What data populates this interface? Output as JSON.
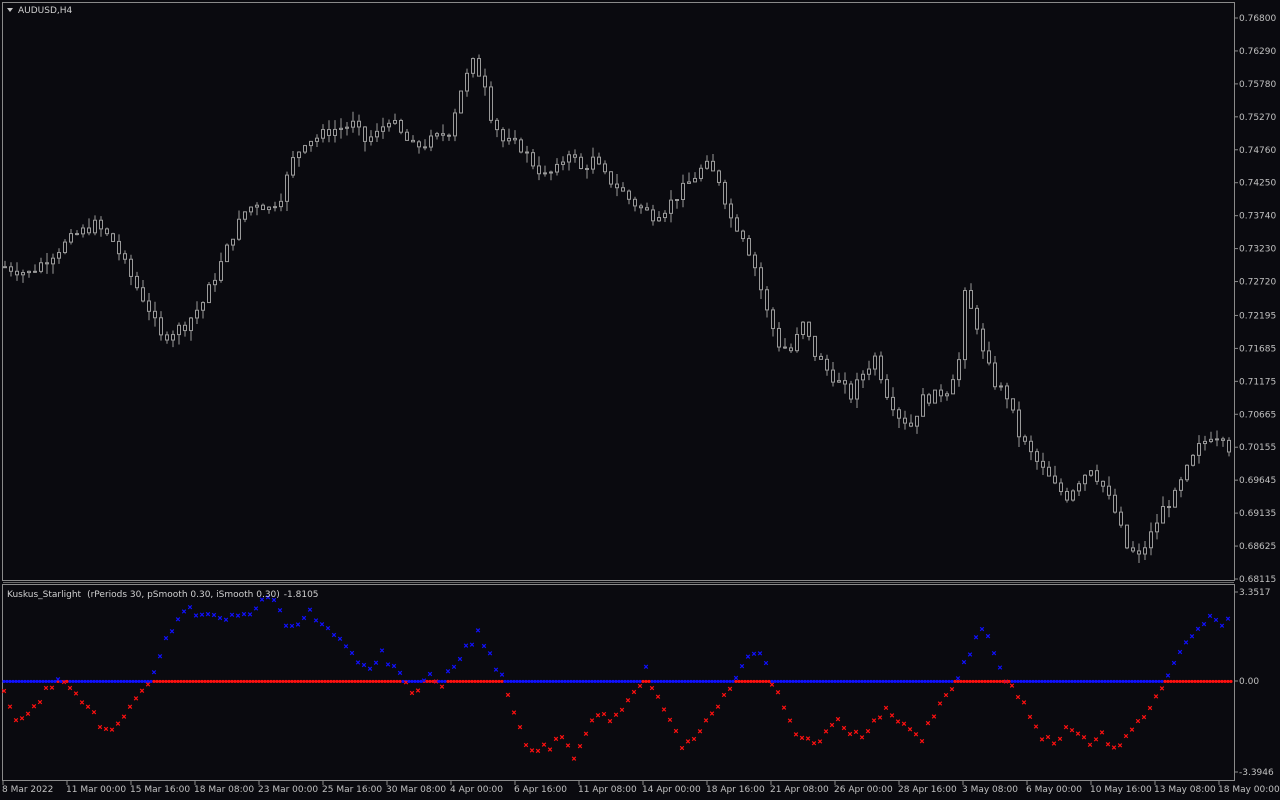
{
  "window": {
    "symbol": "AUDUSD,H4"
  },
  "indicator": {
    "label": "Kuskus_Starlight",
    "params": "(rPeriods 30, pSmooth 0.30, iSmooth 0.30)",
    "value": "-1.8105",
    "max_label": "3.3517",
    "zero_label": "0.00",
    "min_label": "-3.3946"
  },
  "colors": {
    "background": "#0a0a0f",
    "frame": "#8a8a8a",
    "candle": "#9a9a9a",
    "positive": "#1010ff",
    "negative": "#ff1010"
  },
  "price_axis": [
    "0.76800",
    "0.76290",
    "0.75780",
    "0.75270",
    "0.74760",
    "0.74250",
    "0.73740",
    "0.73230",
    "0.72720",
    "0.72195",
    "0.71685",
    "0.71175",
    "0.70665",
    "0.70155",
    "0.69645",
    "0.69135",
    "0.68625",
    "0.68115"
  ],
  "time_axis": [
    "8 Mar 2022",
    "11 Mar 00:00",
    "15 Mar 16:00",
    "18 Mar 08:00",
    "23 Mar 00:00",
    "25 Mar 16:00",
    "30 Mar 08:00",
    "4 Apr 00:00",
    "6 Apr 16:00",
    "11 Apr 08:00",
    "14 Apr 00:00",
    "18 Apr 16:00",
    "21 Apr 08:00",
    "26 Apr 00:00",
    "28 Apr 16:00",
    "3 May 08:00",
    "6 May 00:00",
    "10 May 16:00",
    "13 May 08:00",
    "18 May 00:00"
  ],
  "icons": {
    "dropdown": "triangle-down-icon"
  },
  "chart_data": {
    "type": "candlestick",
    "price_ylim": [
      0.68115,
      0.768
    ],
    "indicator_ylim": [
      -3.3946,
      3.3517
    ],
    "price_path": [
      [
        0,
        0.7295
      ],
      [
        4,
        0.7285
      ],
      [
        8,
        0.7315
      ],
      [
        12,
        0.7345
      ],
      [
        15,
        0.736
      ],
      [
        18,
        0.7335
      ],
      [
        21,
        0.728
      ],
      [
        24,
        0.723
      ],
      [
        26,
        0.7185
      ],
      [
        28,
        0.7195
      ],
      [
        30,
        0.7205
      ],
      [
        33,
        0.724
      ],
      [
        36,
        0.73
      ],
      [
        38,
        0.7345
      ],
      [
        40,
        0.738
      ],
      [
        42,
        0.7395
      ],
      [
        44,
        0.7385
      ],
      [
        46,
        0.7405
      ],
      [
        48,
        0.746
      ],
      [
        50,
        0.749
      ],
      [
        52,
        0.7495
      ],
      [
        54,
        0.7505
      ],
      [
        56,
        0.751
      ],
      [
        58,
        0.7515
      ],
      [
        60,
        0.749
      ],
      [
        62,
        0.75
      ],
      [
        64,
        0.7525
      ],
      [
        66,
        0.75
      ],
      [
        68,
        0.748
      ],
      [
        70,
        0.7485
      ],
      [
        72,
        0.7495
      ],
      [
        74,
        0.7505
      ],
      [
        76,
        0.757
      ],
      [
        78,
        0.761
      ],
      [
        80,
        0.758
      ],
      [
        81,
        0.753
      ],
      [
        83,
        0.749
      ],
      [
        86,
        0.748
      ],
      [
        88,
        0.7455
      ],
      [
        90,
        0.7435
      ],
      [
        92,
        0.7445
      ],
      [
        94,
        0.7475
      ],
      [
        96,
        0.7445
      ],
      [
        98,
        0.746
      ],
      [
        100,
        0.7435
      ],
      [
        102,
        0.742
      ],
      [
        104,
        0.74
      ],
      [
        106,
        0.7385
      ],
      [
        108,
        0.7375
      ],
      [
        110,
        0.7385
      ],
      [
        112,
        0.7405
      ],
      [
        114,
        0.7425
      ],
      [
        116,
        0.7445
      ],
      [
        117,
        0.745
      ],
      [
        119,
        0.743
      ],
      [
        121,
        0.737
      ],
      [
        123,
        0.7345
      ],
      [
        125,
        0.7295
      ],
      [
        127,
        0.7225
      ],
      [
        129,
        0.7175
      ],
      [
        131,
        0.7165
      ],
      [
        133,
        0.7205
      ],
      [
        135,
        0.716
      ],
      [
        137,
        0.7135
      ],
      [
        139,
        0.7115
      ],
      [
        141,
        0.7095
      ],
      [
        143,
        0.713
      ],
      [
        145,
        0.7155
      ],
      [
        147,
        0.71
      ],
      [
        149,
        0.7065
      ],
      [
        151,
        0.705
      ],
      [
        153,
        0.709
      ],
      [
        155,
        0.7095
      ],
      [
        157,
        0.7105
      ],
      [
        159,
        0.715
      ],
      [
        160,
        0.725
      ],
      [
        162,
        0.7205
      ],
      [
        163,
        0.716
      ],
      [
        165,
        0.7115
      ],
      [
        167,
        0.7095
      ],
      [
        169,
        0.7035
      ],
      [
        171,
        0.7005
      ],
      [
        173,
        0.698
      ],
      [
        175,
        0.6955
      ],
      [
        177,
        0.694
      ],
      [
        179,
        0.6965
      ],
      [
        181,
        0.6985
      ],
      [
        183,
        0.6955
      ],
      [
        185,
        0.6915
      ],
      [
        187,
        0.686
      ],
      [
        189,
        0.6845
      ],
      [
        191,
        0.688
      ],
      [
        193,
        0.692
      ],
      [
        195,
        0.694
      ],
      [
        197,
        0.698
      ],
      [
        199,
        0.7015
      ],
      [
        201,
        0.7035
      ],
      [
        203,
        0.7035
      ],
      [
        204,
        0.7015
      ]
    ],
    "indicator_path": [
      [
        0,
        -0.5
      ],
      [
        2,
        -1.4
      ],
      [
        4,
        -1.1
      ],
      [
        6,
        -0.6
      ],
      [
        8,
        -0.2
      ],
      [
        10,
        0.1
      ],
      [
        12,
        -0.3
      ],
      [
        14,
        -1.0
      ],
      [
        16,
        -1.6
      ],
      [
        18,
        -1.9
      ],
      [
        20,
        -1.4
      ],
      [
        22,
        -0.8
      ],
      [
        24,
        -0.2
      ],
      [
        25,
        0.4
      ],
      [
        27,
        1.6
      ],
      [
        29,
        2.4
      ],
      [
        31,
        2.7
      ],
      [
        33,
        2.5
      ],
      [
        35,
        2.6
      ],
      [
        37,
        2.3
      ],
      [
        39,
        2.5
      ],
      [
        41,
        2.6
      ],
      [
        43,
        3.1
      ],
      [
        45,
        2.9
      ],
      [
        47,
        2.2
      ],
      [
        49,
        2.3
      ],
      [
        51,
        2.6
      ],
      [
        53,
        2.1
      ],
      [
        55,
        1.9
      ],
      [
        57,
        1.3
      ],
      [
        59,
        0.8
      ],
      [
        61,
        0.6
      ],
      [
        63,
        1.0
      ],
      [
        65,
        0.5
      ],
      [
        67,
        -0.2
      ],
      [
        69,
        -0.4
      ],
      [
        71,
        0.2
      ],
      [
        73,
        -0.1
      ],
      [
        75,
        0.6
      ],
      [
        77,
        1.2
      ],
      [
        79,
        1.9
      ],
      [
        81,
        1.0
      ],
      [
        83,
        0.1
      ],
      [
        85,
        -1.2
      ],
      [
        87,
        -2.3
      ],
      [
        89,
        -2.6
      ],
      [
        91,
        -2.4
      ],
      [
        93,
        -2.2
      ],
      [
        95,
        -2.8
      ],
      [
        97,
        -2.0
      ],
      [
        99,
        -1.1
      ],
      [
        101,
        -1.6
      ],
      [
        103,
        -1.2
      ],
      [
        105,
        -0.4
      ],
      [
        107,
        0.4
      ],
      [
        109,
        -0.6
      ],
      [
        111,
        -1.6
      ],
      [
        113,
        -2.4
      ],
      [
        115,
        -2.1
      ],
      [
        117,
        -1.3
      ],
      [
        119,
        -0.9
      ],
      [
        121,
        -0.4
      ],
      [
        123,
        0.6
      ],
      [
        125,
        1.2
      ],
      [
        127,
        0.6
      ],
      [
        129,
        -0.5
      ],
      [
        131,
        -1.6
      ],
      [
        133,
        -2.2
      ],
      [
        135,
        -2.4
      ],
      [
        137,
        -1.9
      ],
      [
        139,
        -1.4
      ],
      [
        141,
        -1.8
      ],
      [
        143,
        -2.2
      ],
      [
        145,
        -1.5
      ],
      [
        147,
        -0.9
      ],
      [
        149,
        -1.4
      ],
      [
        151,
        -1.9
      ],
      [
        153,
        -2.1
      ],
      [
        155,
        -1.3
      ],
      [
        157,
        -0.6
      ],
      [
        159,
        0.2
      ],
      [
        161,
        1.1
      ],
      [
        163,
        2.1
      ],
      [
        165,
        1.1
      ],
      [
        167,
        0.1
      ],
      [
        169,
        -0.6
      ],
      [
        171,
        -1.2
      ],
      [
        173,
        -2.0
      ],
      [
        175,
        -2.4
      ],
      [
        177,
        -1.6
      ],
      [
        179,
        -1.9
      ],
      [
        181,
        -2.3
      ],
      [
        183,
        -1.8
      ],
      [
        185,
        -2.6
      ],
      [
        187,
        -2.2
      ],
      [
        189,
        -1.6
      ],
      [
        191,
        -0.9
      ],
      [
        193,
        -0.2
      ],
      [
        195,
        0.6
      ],
      [
        197,
        1.6
      ],
      [
        199,
        2.1
      ],
      [
        201,
        2.4
      ],
      [
        203,
        2.2
      ]
    ]
  }
}
